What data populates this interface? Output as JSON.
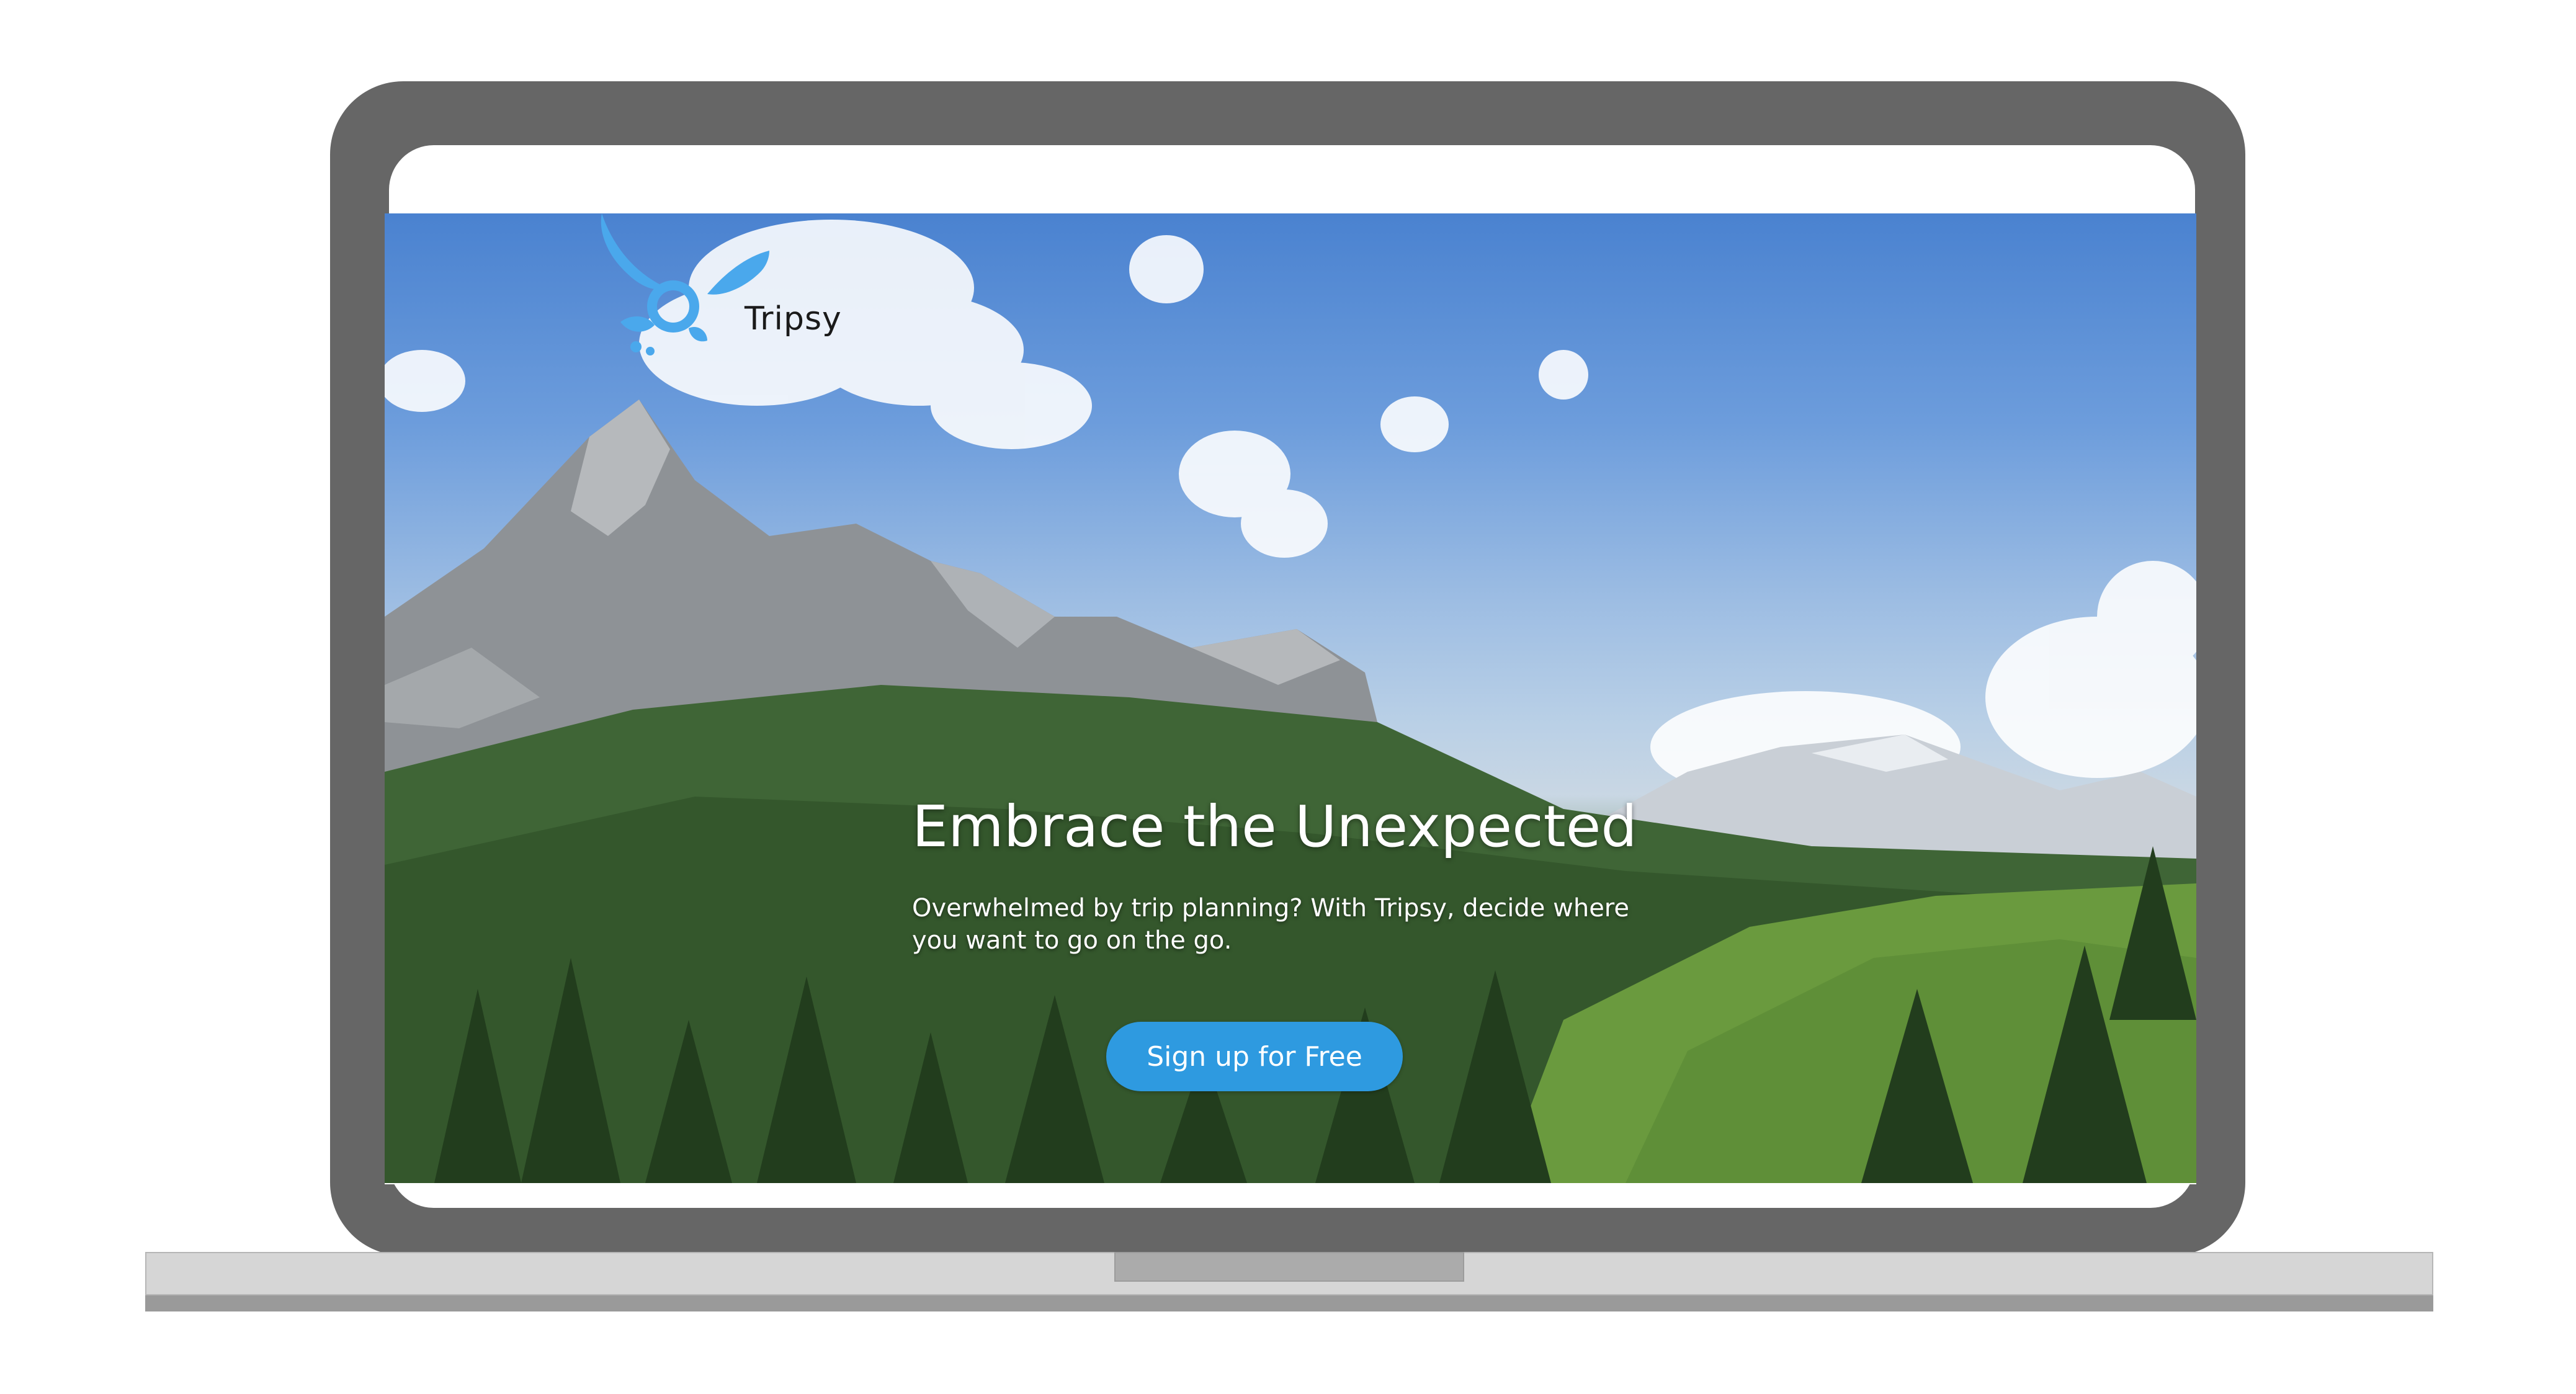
{
  "brand": {
    "name": "Tripsy",
    "logo_icon": "tripsy-butterfly-logo-icon",
    "color": "#4aa8ec"
  },
  "hero": {
    "title": "Embrace the Unexpected",
    "subtitle": "Overwhelmed by trip planning? With Tripsy, decide where you want to go on the go.",
    "background": "mountain-forest-landscape"
  },
  "cta": {
    "label": "Sign up for Free",
    "color": "#2e9ae0"
  },
  "device": {
    "frame_color": "#666666",
    "base_color": "#d6d6d6"
  }
}
